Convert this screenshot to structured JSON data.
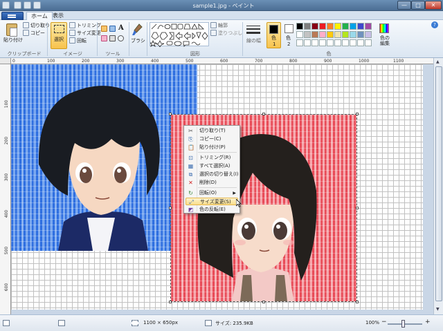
{
  "window": {
    "title": "sample1.jpg - ペイント",
    "minimize": "—",
    "maximize": "□",
    "close": "✕"
  },
  "tabs": {
    "home": "ホーム",
    "view": "表示"
  },
  "clipboard": {
    "paste": "貼り付け",
    "cut": "切り取り",
    "copy": "コピー",
    "group": "クリップボード"
  },
  "image": {
    "select": "選択",
    "crop": "トリミング",
    "resize": "サイズ変更",
    "rotate": "回転",
    "group": "イメージ"
  },
  "tools": {
    "group": "ツール",
    "text": "A"
  },
  "brush": {
    "label": "ブラシ"
  },
  "shapes": {
    "outline": "輪郭",
    "fill": "塗りつぶし",
    "group": "図形"
  },
  "size": {
    "label": "線の幅"
  },
  "colors": {
    "color1": "色",
    "color1_num": "1",
    "color2": "色",
    "color2_num": "2",
    "edit": "色の編集",
    "group": "色",
    "palette": [
      "#000000",
      "#7f7f7f",
      "#880015",
      "#ed1c24",
      "#ff7f27",
      "#fff200",
      "#22b14c",
      "#00a2e8",
      "#3f48cc",
      "#a349a4",
      "#ffffff",
      "#c3c3c3",
      "#b97a57",
      "#ffaec9",
      "#ffc90e",
      "#efe4b0",
      "#b5e61d",
      "#99d9ea",
      "#7092be",
      "#c8bfe7",
      "#ffffff",
      "#ffffff",
      "#ffffff",
      "#ffffff",
      "#ffffff",
      "#ffffff",
      "#ffffff",
      "#ffffff",
      "#ffffff",
      "#ffffff"
    ]
  },
  "help": "?",
  "ruler_h": [
    "0",
    "100",
    "200",
    "300",
    "400",
    "500",
    "600",
    "700",
    "800",
    "900",
    "1000",
    "1100"
  ],
  "ruler_v": [
    "100",
    "200",
    "300",
    "400",
    "500",
    "600"
  ],
  "context_menu": {
    "items": [
      {
        "icon": "✂",
        "label": "切り取り(T)"
      },
      {
        "icon": "⎘",
        "label": "コピー(C)"
      },
      {
        "icon": "📋",
        "label": "貼り付け(P)"
      },
      {
        "icon": "⊡",
        "label": "トリミング(R)"
      },
      {
        "icon": "▦",
        "label": "すべて選択(A)"
      },
      {
        "icon": "⧉",
        "label": "選択の切り替え(I)"
      },
      {
        "icon": "✕",
        "label": "削除(D)"
      },
      {
        "icon": "↻",
        "label": "回転(O)",
        "arrow": "▶"
      },
      {
        "icon": "⤢",
        "label": "サイズ変更(S)"
      },
      {
        "icon": "◩",
        "label": "色の反転(E)"
      }
    ]
  },
  "status": {
    "dimensions": "1100 × 650px",
    "filesize": "サイズ: 235.9KB",
    "zoom": "100%",
    "zoom_minus": "−",
    "zoom_plus": "+"
  }
}
